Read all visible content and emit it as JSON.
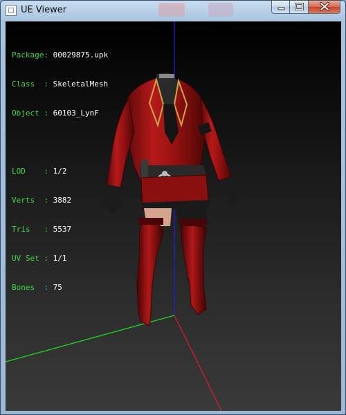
{
  "window": {
    "title": "UE Viewer"
  },
  "controls": {
    "minimize": "minimize",
    "maximize": "maximize",
    "close": "close"
  },
  "info_top": [
    {
      "label": "Package:",
      "value": "00029875.upk"
    },
    {
      "label": "Class  :",
      "value": "SkeletalMesh"
    },
    {
      "label": "Object :",
      "value": "60103_LynF"
    }
  ],
  "info_mesh": [
    {
      "label": "LOD    :",
      "value": "1/2"
    },
    {
      "label": "Verts  :",
      "value": "3882"
    },
    {
      "label": "Tris   :",
      "value": "5537"
    },
    {
      "label": "UV Set :",
      "value": "1/1"
    },
    {
      "label": "Bones  :",
      "value": "75"
    }
  ],
  "colors": {
    "label_text": "#3fdc3f",
    "value_text": "#ffffff",
    "axis_x": "#d81e1e",
    "axis_y": "#1ed81e",
    "axis_z": "#1e1ed8",
    "outfit": "#9c1414"
  }
}
